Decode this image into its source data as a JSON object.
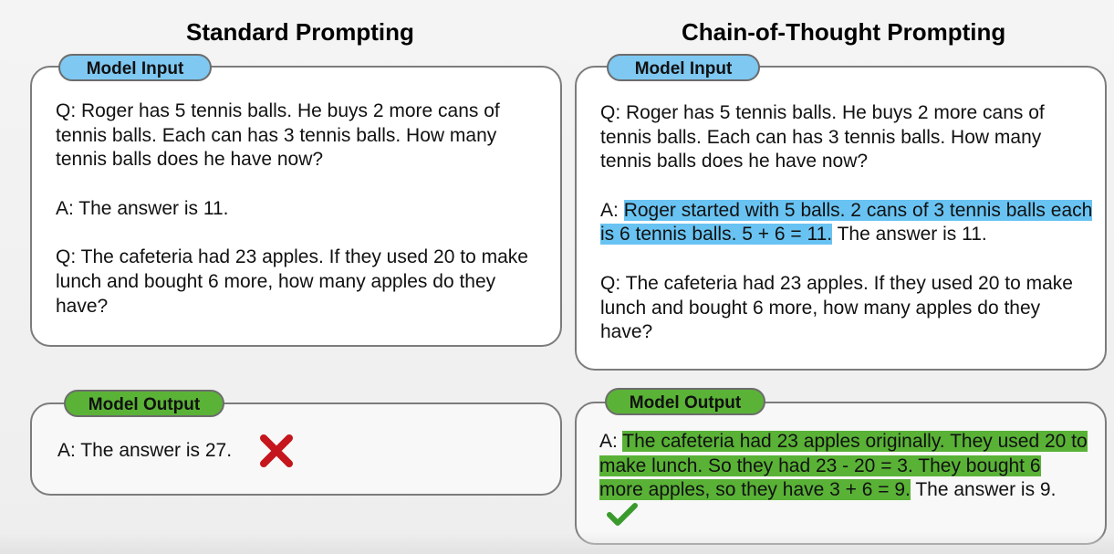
{
  "standard": {
    "title": "Standard Prompting",
    "input": {
      "label": "Model Input",
      "q1": "Q: Roger has 5 tennis balls. He buys 2 more cans of tennis balls. Each can has 3 tennis balls. How many tennis balls does he have now?",
      "a1": "A: The answer is 11.",
      "q2": "Q: The cafeteria had 23 apples. If they used 20 to make lunch and bought 6 more, how many apples do they have?"
    },
    "output": {
      "label": "Model Output",
      "answer": "A: The answer is 27.",
      "verdict_icon": "cross-icon",
      "verdict_color": "#c4161c"
    }
  },
  "cot": {
    "title": "Chain-of-Thought Prompting",
    "input": {
      "label": "Model Input",
      "q1": "Q: Roger has 5 tennis balls. He buys 2 more cans of tennis balls. Each can has 3 tennis balls. How many tennis balls does he have now?",
      "a1_prefix": "A: ",
      "a1_reasoning": "Roger started with 5 balls. 2 cans of 3 tennis balls each is 6 tennis balls. 5 + 6 = 11.",
      "a1_answer": " The answer is 11.",
      "q2": "Q: The cafeteria had 23 apples. If they used 20 to make lunch and bought 6 more, how many apples do they have?"
    },
    "output": {
      "label": "Model Output",
      "prefix": "A: ",
      "reasoning": "The cafeteria had 23 apples originally. They used 20 to make lunch. So they had 23 - 20 = 3. They bought 6 more apples, so they have 3 + 6 = 9.",
      "answer": " The answer is 9.",
      "verdict_icon": "checkmark-icon",
      "verdict_color": "#3a9a2c"
    }
  },
  "colors": {
    "input_pill": "#7ec8f2",
    "output_pill": "#5ab336",
    "reasoning_highlight_input": "#69c3f2",
    "reasoning_highlight_output": "#59b236"
  }
}
